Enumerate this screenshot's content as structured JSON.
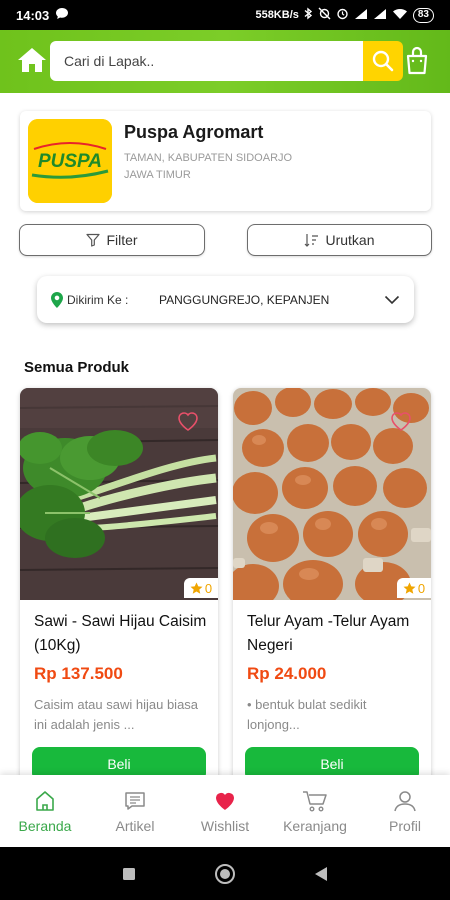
{
  "status_bar": {
    "time": "14:03",
    "speed": "558KB/s",
    "battery": "83"
  },
  "header": {
    "search_placeholder": "Cari di Lapak..",
    "search_value": "",
    "brand_color": "#6fc21c",
    "search_button_color": "#ffd400"
  },
  "store": {
    "name": "Puspa Agromart",
    "address_line1": "TAMAN, KABUPATEN SIDOARJO",
    "address_line2": "JAWA TIMUR",
    "logo_text": "PUSPA"
  },
  "filters": {
    "filter_label": "Filter",
    "sort_label": "Urutkan"
  },
  "delivery": {
    "label": "Dikirim Ke :",
    "location": "PANGGUNGREJO, KEPANJEN"
  },
  "section_title": "Semua Produk",
  "products": [
    {
      "name": "Sawi - Sawi Hijau Caisim (10Kg)",
      "price": "Rp 137.500",
      "description": "Caisim atau sawi hijau biasa ini adalah jenis ...",
      "rating": "0",
      "buy_label": "Beli",
      "image_icon": "mustard-greens-photo"
    },
    {
      "name": "Telur Ayam -Telur Ayam Negeri",
      "price": "Rp 24.000",
      "description": "• bentuk bulat sedikit lonjong...",
      "rating": "0",
      "buy_label": "Beli",
      "image_icon": "eggs-tray-photo"
    }
  ],
  "bottom_nav": {
    "items": [
      {
        "label": "Beranda",
        "icon": "home-icon",
        "active": true
      },
      {
        "label": "Artikel",
        "icon": "article-icon",
        "active": false
      },
      {
        "label": "Wishlist",
        "icon": "heart-icon",
        "active": false
      },
      {
        "label": "Keranjang",
        "icon": "cart-icon",
        "active": false
      },
      {
        "label": "Profil",
        "icon": "profile-icon",
        "active": false
      }
    ],
    "active_color": "#3aa84a",
    "price_color": "#f04a12",
    "buy_color": "#18b93c"
  }
}
